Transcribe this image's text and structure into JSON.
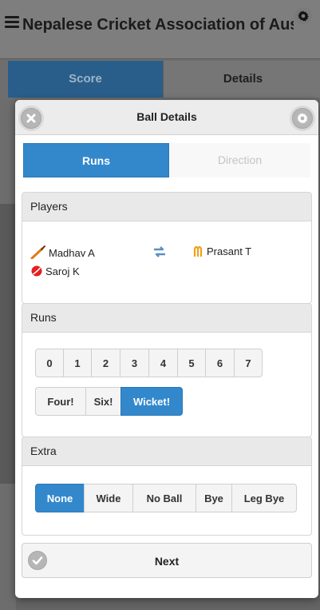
{
  "app": {
    "title": "Nepalese Cricket Association of Australia",
    "menu_icon": "menu-icon",
    "settings_icon": "gear-icon"
  },
  "background_tabs": [
    {
      "label": "Score",
      "active": true
    },
    {
      "label": "Details",
      "active": false
    }
  ],
  "dialog": {
    "title": "Ball Details",
    "close_icon": "close-icon",
    "settings_icon": "gear-icon",
    "tabs": [
      {
        "label": "Runs",
        "active": true
      },
      {
        "label": "Direction",
        "active": false
      }
    ],
    "players": {
      "header": "Players",
      "batsman": {
        "name": "Madhav A",
        "icon": "cricket-bat-icon"
      },
      "swap_icon": "swap-arrows-icon",
      "non_striker": {
        "name": "Prasant T",
        "icon": "runner-icon"
      },
      "bowler": {
        "name": "Saroj K",
        "icon": "cricket-ball-icon"
      }
    },
    "runs": {
      "header": "Runs",
      "options": [
        "0",
        "1",
        "2",
        "3",
        "4",
        "5",
        "6",
        "7"
      ],
      "specials": [
        {
          "label": "Four!",
          "active": false
        },
        {
          "label": "Six!",
          "active": false
        },
        {
          "label": "Wicket!",
          "active": true
        }
      ]
    },
    "extra": {
      "header": "Extra",
      "options": [
        {
          "label": "None",
          "active": true
        },
        {
          "label": "Wide",
          "active": false
        },
        {
          "label": "No Ball",
          "active": false
        },
        {
          "label": "Bye",
          "active": false
        },
        {
          "label": "Leg Bye",
          "active": false
        }
      ]
    },
    "next": {
      "label": "Next",
      "icon": "check-icon"
    }
  },
  "colors": {
    "accent": "#3388cc",
    "overlay": "#6e6e6e",
    "section_header": "#e9e9e9"
  }
}
